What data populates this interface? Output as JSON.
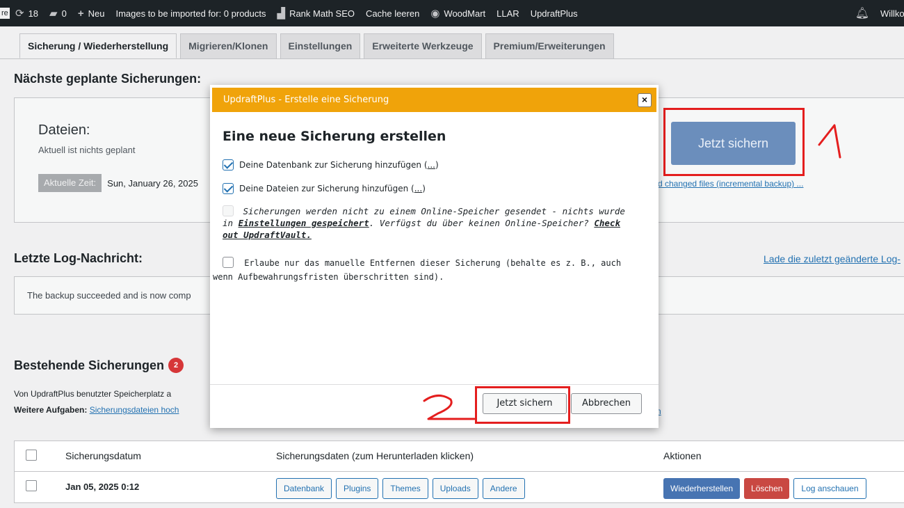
{
  "adminbar": {
    "cut_label": "re",
    "updates_count": "18",
    "comments_count": "0",
    "new_label": "Neu",
    "import_notice": "Images to be imported for: 0 products",
    "rankmath": "Rank Math SEO",
    "cache": "Cache leeren",
    "woodmart": "WoodMart",
    "llar": "LLAR",
    "updraftplus": "UpdraftPlus",
    "greeting": "Willko"
  },
  "tabs": [
    {
      "label": "Sicherung / Wiederherstellung",
      "active": true
    },
    {
      "label": "Migrieren/Klonen"
    },
    {
      "label": "Einstellungen"
    },
    {
      "label": "Erweiterte Werkzeuge"
    },
    {
      "label": "Premium/Erweiterungen"
    }
  ],
  "scheduled": {
    "heading": "Nächste geplante Sicherungen:",
    "files_title": "Dateien:",
    "files_sub": "Aktuell ist nichts geplant",
    "time_label": "Aktuelle Zeit:",
    "time_value": "Sun, January 26, 2025",
    "backup_now": "Jetzt sichern",
    "incremental_link": "d changed files (incremental backup) ..."
  },
  "log": {
    "heading": "Letzte Log-Nachricht:",
    "message": "The backup succeeded and is now comp",
    "download_link": "Lade die zuletzt geänderte Log-"
  },
  "existing": {
    "heading": "Bestehende Sicherungen",
    "count": "2",
    "storage_line": "Von UpdraftPlus benutzter Speicherplatz a",
    "tasks_label": "Weitere Aufgaben:",
    "tasks_link": "Sicherungsdateien hoch",
    "tasks_tail": "n"
  },
  "table": {
    "headers": [
      "Sicherungsdatum",
      "Sicherungsdaten (zum Herunterladen klicken)",
      "Aktionen"
    ],
    "rows": [
      {
        "date": "Jan 05, 2025 0:12",
        "downloads": [
          "Datenbank",
          "Plugins",
          "Themes",
          "Uploads",
          "Andere"
        ],
        "actions": [
          "Wiederherstellen",
          "Löschen",
          "Log anschauen"
        ]
      }
    ]
  },
  "modal": {
    "title": "UpdraftPlus - Erstelle eine Sicherung",
    "close": "×",
    "heading": "Eine neue Sicherung erstellen",
    "opt_db": "Deine Datenbank zur Sicherung hinzufügen (",
    "opt_db_link": "...",
    "opt_files": "Deine Dateien zur Sicherung hinzufügen (",
    "opt_files_link": "...",
    "close_paren": ")",
    "remote_text1": "Sicherungen werden nicht zu einem Online-Speicher gesendet - nichts wurde in",
    "remote_link1": "Einstellungen gespeichert",
    "remote_text2": ". Verfügst du über keinen Online-Speicher?",
    "remote_link2": "Check out UpdraftVault.",
    "manual_delete": "Erlaube nur das manuelle Entfernen dieser Sicherung (behalte es z. B., auch wenn Aufbewahrungsfristen überschritten sind).",
    "backup_button": "Jetzt sichern",
    "cancel_button": "Abbrechen"
  },
  "annotations": {
    "step1": "1",
    "step2": "2"
  }
}
